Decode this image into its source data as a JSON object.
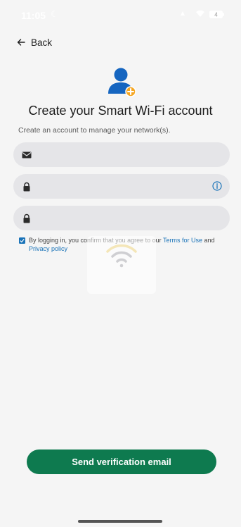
{
  "status_bar": {
    "time": "11:05",
    "battery": "4"
  },
  "header": {
    "back_label": "Back"
  },
  "page": {
    "title": "Create your Smart Wi-Fi account",
    "subtitle": "Create an account to manage your network(s)."
  },
  "form": {
    "email": {
      "value": "",
      "placeholder": "",
      "icon": "email-icon"
    },
    "password": {
      "value": "",
      "placeholder": "",
      "icon": "lock-icon",
      "info_icon": "info-icon"
    },
    "confirm_password": {
      "value": "",
      "placeholder": "",
      "icon": "lock-icon"
    }
  },
  "terms": {
    "checked": true,
    "prefix": "By logging in, you confirm that you agree to our ",
    "terms_link": "Terms for Use",
    "conjunction": " and ",
    "privacy_link": "Privacy policy"
  },
  "actions": {
    "send_label": "Send verification email"
  },
  "colors": {
    "background": "#f5f5f5",
    "primary_button": "#0e7a4f",
    "link": "#1a73b8",
    "field_bg": "#e5e5e8",
    "avatar_blue": "#1565c0",
    "avatar_badge": "#f5a623"
  }
}
